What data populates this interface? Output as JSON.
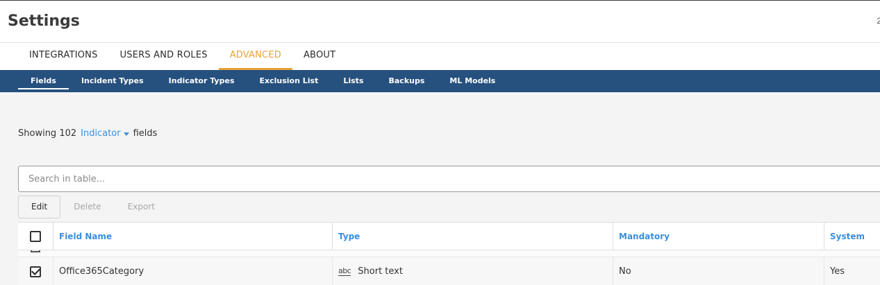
{
  "header": {
    "title": "Settings",
    "edge_mark": "2"
  },
  "main_tabs": [
    {
      "label": "INTEGRATIONS"
    },
    {
      "label": "USERS AND ROLES"
    },
    {
      "label": "ADVANCED",
      "active": true
    },
    {
      "label": "ABOUT"
    }
  ],
  "sub_tabs": [
    {
      "label": "Fields",
      "active": true
    },
    {
      "label": "Incident Types"
    },
    {
      "label": "Indicator Types"
    },
    {
      "label": "Exclusion List"
    },
    {
      "label": "Lists"
    },
    {
      "label": "Backups"
    },
    {
      "label": "ML Models"
    }
  ],
  "showing": {
    "prefix": "Showing 102",
    "selected_type": "Indicator",
    "suffix": "fields"
  },
  "search": {
    "placeholder": "Search in table...",
    "value": ""
  },
  "toolbar": {
    "edit_label": "Edit",
    "delete_label": "Delete",
    "export_label": "Export"
  },
  "table": {
    "columns": [
      "Field Name",
      "Type",
      "Mandatory",
      "System"
    ],
    "rows": [
      {
        "checked": true,
        "field_name": "Office365Category",
        "type_icon": "abc",
        "type": "Short text",
        "mandatory": "No",
        "system": "Yes"
      }
    ]
  },
  "colors": {
    "accent": "#e8a33a",
    "nav_bar": "#26507d",
    "link": "#3a8fe0"
  }
}
